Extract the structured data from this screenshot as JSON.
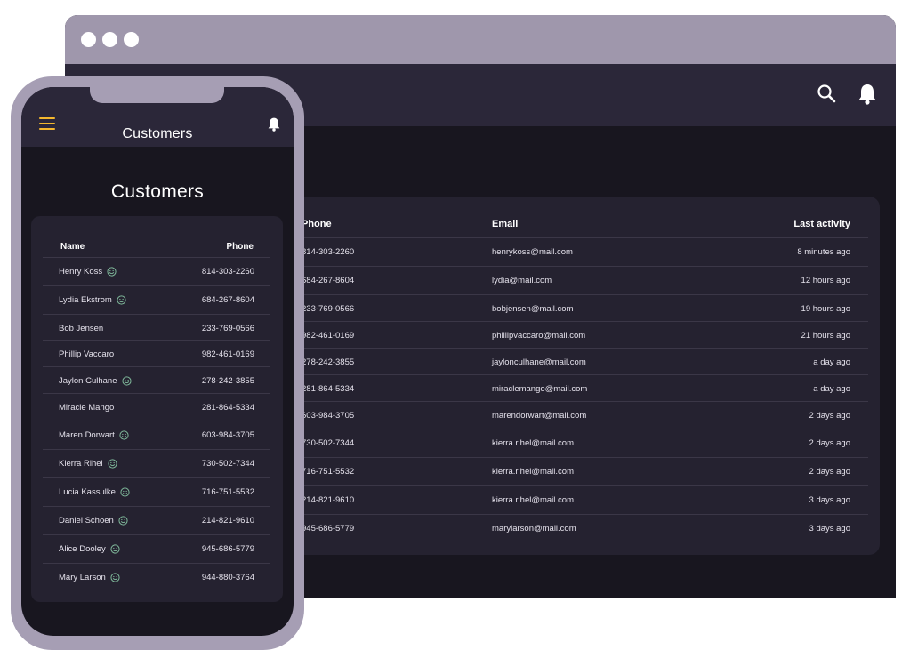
{
  "desktop": {
    "columns": {
      "phone": "Phone",
      "email": "Email",
      "last_activity": "Last activity"
    },
    "rows": [
      {
        "phone": "814-303-2260",
        "email": "henrykoss@mail.com",
        "activity": "8 minutes ago"
      },
      {
        "phone": "684-267-8604",
        "email": "lydia@mail.com",
        "activity": "12 hours ago"
      },
      {
        "phone": "233-769-0566",
        "email": "bobjensen@mail.com",
        "activity": "19 hours ago"
      },
      {
        "phone": "982-461-0169",
        "email": "phillipvaccaro@mail.com",
        "activity": "21 hours ago"
      },
      {
        "phone": "278-242-3855",
        "email": "jaylonculhane@mail.com",
        "activity": "a day ago"
      },
      {
        "phone": "281-864-5334",
        "email": "miraclemango@mail.com",
        "activity": "a day ago"
      },
      {
        "phone": "603-984-3705",
        "email": "marendorwart@mail.com",
        "activity": "2 days ago"
      },
      {
        "phone": "730-502-7344",
        "email": "kierra.rihel@mail.com",
        "activity": "2 days ago"
      },
      {
        "phone": "716-751-5532",
        "email": "kierra.rihel@mail.com",
        "activity": "2 days ago"
      },
      {
        "phone": "214-821-9610",
        "email": "kierra.rihel@mail.com",
        "activity": "3 days ago"
      },
      {
        "phone": "945-686-5779",
        "email": "marylarson@mail.com",
        "activity": "3 days ago"
      }
    ]
  },
  "mobile": {
    "header_title": "Customers",
    "page_heading": "Customers",
    "columns": {
      "name": "Name",
      "phone": "Phone"
    },
    "rows": [
      {
        "name": "Henry Koss",
        "phone": "814-303-2260",
        "smiley": true
      },
      {
        "name": "Lydia Ekstrom",
        "phone": "684-267-8604",
        "smiley": true
      },
      {
        "name": "Bob Jensen",
        "phone": "233-769-0566",
        "smiley": false
      },
      {
        "name": "Phillip Vaccaro",
        "phone": "982-461-0169",
        "smiley": false
      },
      {
        "name": "Jaylon Culhane",
        "phone": "278-242-3855",
        "smiley": true
      },
      {
        "name": "Miracle Mango",
        "phone": "281-864-5334",
        "smiley": false
      },
      {
        "name": "Maren Dorwart",
        "phone": "603-984-3705",
        "smiley": true
      },
      {
        "name": "Kierra Rihel",
        "phone": "730-502-7344",
        "smiley": true
      },
      {
        "name": "Lucia Kassulke",
        "phone": "716-751-5532",
        "smiley": true
      },
      {
        "name": "Daniel Schoen",
        "phone": "214-821-9610",
        "smiley": true
      },
      {
        "name": "Alice Dooley",
        "phone": "945-686-5779",
        "smiley": true
      },
      {
        "name": "Mary Larson",
        "phone": "944-880-3764",
        "smiley": true
      }
    ]
  },
  "icons": {
    "menu": "hamburger-menu-icon",
    "bell": "bell-icon",
    "search": "search-icon",
    "smiley": "smiley-face-icon"
  },
  "colors": {
    "frame": "#9f97ac",
    "header": "#2b2739",
    "background": "#18161f",
    "card": "#252230",
    "accent": "#f5b82e",
    "smiley": "#7fb89a"
  }
}
